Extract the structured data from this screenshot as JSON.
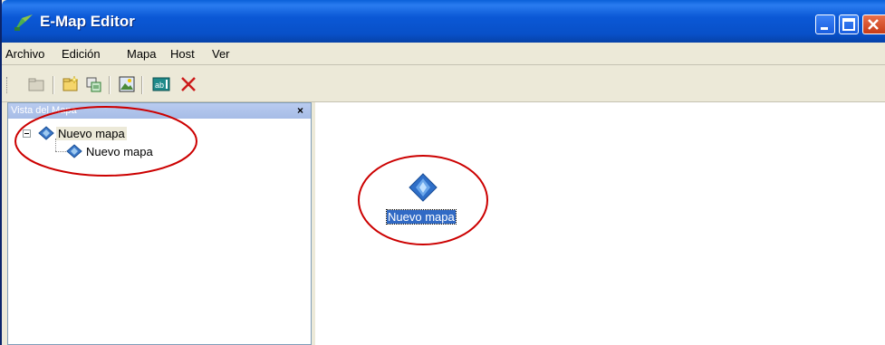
{
  "window": {
    "title": "E-Map Editor",
    "controls": [
      "minimize",
      "maximize",
      "close"
    ]
  },
  "menu": {
    "items": [
      "Archivo",
      "Edición",
      "Mapa",
      "Host",
      "Ver"
    ]
  },
  "toolbar": {
    "tools": [
      "folder-icon",
      "new-map-icon",
      "copy-map-icon",
      "image-icon",
      "text-icon",
      "delete-icon"
    ]
  },
  "map_panel": {
    "title": "Vista del Mapa",
    "close_label": "×",
    "tree": {
      "root": "Nuevo mapa",
      "child": "Nuevo mapa"
    }
  },
  "canvas": {
    "item_label": "Nuevo mapa"
  },
  "colors": {
    "annotation": "#cc0000",
    "selection": "#316ac5",
    "titlebar": "#0b58d6"
  }
}
